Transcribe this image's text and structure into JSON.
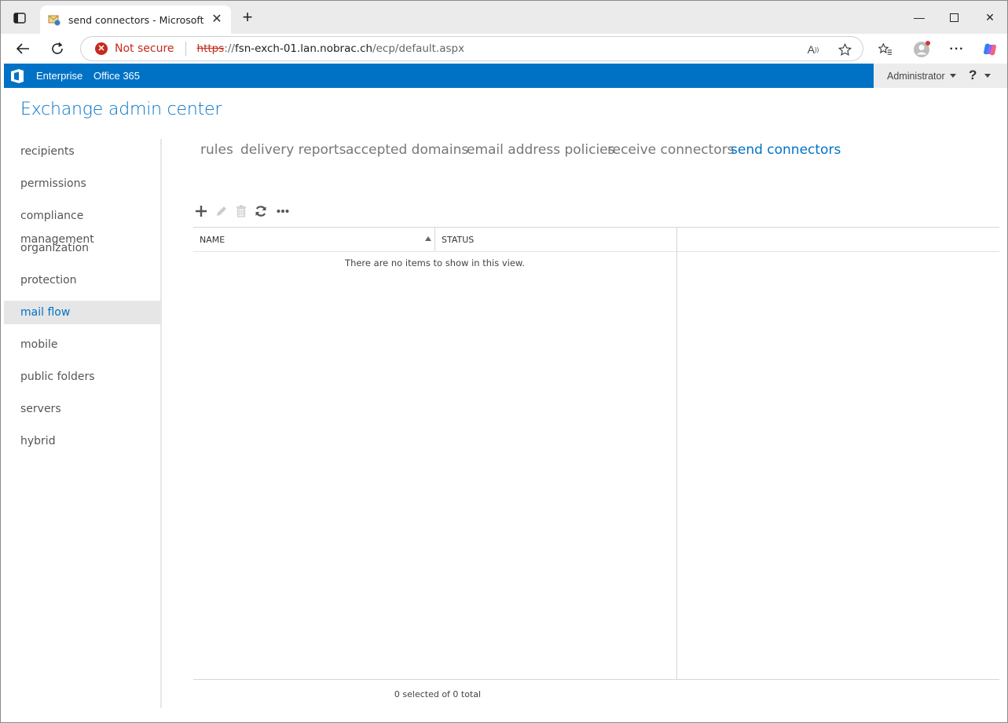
{
  "browser": {
    "tab_title": "send connectors - Microsoft Exch",
    "security_label": "Not secure",
    "url_scheme": "https",
    "url_sep": "://",
    "url_host": "fsn-exch-01.lan.nobrac.ch",
    "url_path": "/ecp/default.aspx",
    "accent_color": "#c42b1c"
  },
  "eac": {
    "brand_color": "#0072c6",
    "top_tabs": [
      "Enterprise",
      "Office 365"
    ],
    "user": "Administrator",
    "help": "?",
    "title": "Exchange admin center"
  },
  "leftnav": {
    "items": [
      "recipients",
      "permissions",
      "compliance management",
      "organization",
      "protection",
      "mail flow",
      "mobile",
      "public folders",
      "servers",
      "hybrid"
    ],
    "active": "mail flow"
  },
  "subtabs": {
    "items": [
      "rules",
      "delivery reports",
      "accepted domains",
      "email address policies",
      "receive connectors",
      "send connectors"
    ],
    "active": "send connectors"
  },
  "actions": [
    "add-icon",
    "edit-icon",
    "delete-icon",
    "refresh-icon",
    "more-icon"
  ],
  "grid": {
    "columns": [
      "NAME",
      "STATUS"
    ],
    "sort_column": "NAME",
    "sort_direction": "ascending",
    "rows": [],
    "empty_message": "There are no items to show in this view.",
    "count_text": "0 selected of 0 total"
  }
}
